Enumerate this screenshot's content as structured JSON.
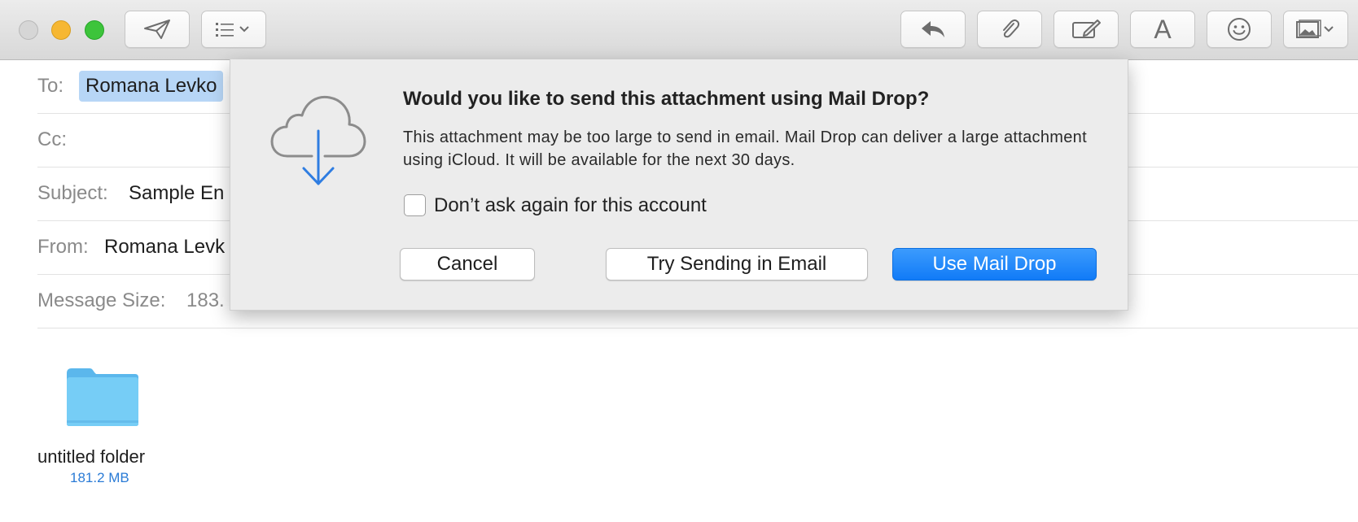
{
  "toolbar": {
    "buttons": [
      {
        "icon": "send-icon"
      },
      {
        "icon": "header-fields-icon"
      },
      {
        "icon": "reply-icon"
      },
      {
        "icon": "attachment-icon"
      },
      {
        "icon": "markup-icon"
      },
      {
        "icon": "format-text-icon"
      },
      {
        "icon": "emoji-icon"
      },
      {
        "icon": "photo-browser-icon"
      }
    ],
    "format_glyph": "A"
  },
  "header": {
    "to_label": "To:",
    "to_value": "Romana Levko",
    "cc_label": "Cc:",
    "subject_label": "Subject:",
    "subject_value": "Sample En",
    "from_label": "From:",
    "from_value": "Romana Levk",
    "size_label": "Message Size:",
    "size_value": "183."
  },
  "attachment": {
    "icon": "folder-icon",
    "name": "untitled folder",
    "size": "181.2 MB"
  },
  "dialog": {
    "icon": "icloud-download-icon",
    "title": "Would you like to send this attachment using Mail Drop?",
    "message": "This attachment may be too large to send in email. Mail Drop can deliver a large attachment using iCloud. It will be available for the next 30 days.",
    "checkbox_label": "Don’t ask again for this account",
    "checkbox_checked": false,
    "cancel_label": "Cancel",
    "try_email_label": "Try Sending in Email",
    "mail_drop_label": "Use Mail Drop"
  },
  "colors": {
    "accent": "#117bf7",
    "token_bg": "#b7d6f6",
    "folder": "#6cc3f2",
    "size_text": "#2a7bd6"
  }
}
